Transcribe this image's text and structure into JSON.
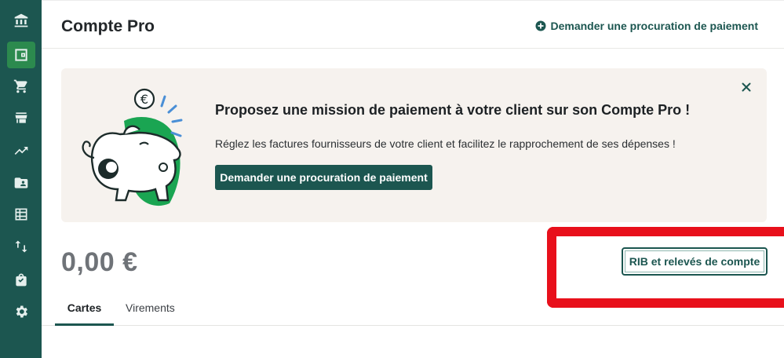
{
  "sidebar": {
    "items": [
      {
        "icon": "bank-icon",
        "active": false
      },
      {
        "icon": "wallet-icon",
        "active": true
      },
      {
        "icon": "cart-icon",
        "active": false
      },
      {
        "icon": "store-icon",
        "active": false
      },
      {
        "icon": "trending-up-icon",
        "active": false
      },
      {
        "icon": "folder-account-icon",
        "active": false
      },
      {
        "icon": "table-icon",
        "active": false
      },
      {
        "icon": "transfer-icon",
        "active": false
      },
      {
        "icon": "bag-icon",
        "active": false
      },
      {
        "icon": "gear-icon",
        "active": false
      }
    ],
    "bg_color": "#1c5650",
    "active_color": "#2c8a4e"
  },
  "header": {
    "title": "Compte Pro",
    "action_label": "Demander une procuration de paiement"
  },
  "banner": {
    "title": "Proposez une mission de paiement à votre client sur son Compte Pro !",
    "description": "Réglez les factures fournisseurs de votre client et facilitez le rapprochement de ses dépenses !",
    "button_label": "Demander une procuration de paiement"
  },
  "account": {
    "balance": "0,00 €",
    "statements_button": "RIB et relevés de compte"
  },
  "tabs": [
    {
      "label": "Cartes",
      "active": true
    },
    {
      "label": "Virements",
      "active": false
    }
  ],
  "colors": {
    "primary": "#1c5650",
    "highlight": "#e8101b",
    "banner_bg": "#f6f2ee"
  }
}
